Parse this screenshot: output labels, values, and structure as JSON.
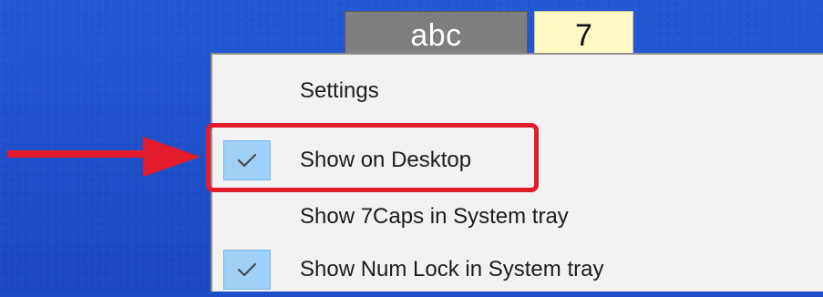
{
  "indicators": {
    "caps_label": "abc",
    "num_label": "7"
  },
  "menu": {
    "items": [
      {
        "label": "Settings",
        "checked": false
      },
      {
        "label": "Show on Desktop",
        "checked": true
      },
      {
        "label": "Show 7Caps in System tray",
        "checked": false
      },
      {
        "label": "Show Num Lock in System tray",
        "checked": true
      }
    ]
  },
  "colors": {
    "desktop": "#1f4fc8",
    "menu_background": "#f2f2f2",
    "check_highlight": "#9fd0f7",
    "annotation": "#e21b2d"
  },
  "icons": {
    "check": "checkmark-icon",
    "arrow": "arrow-right-icon"
  }
}
